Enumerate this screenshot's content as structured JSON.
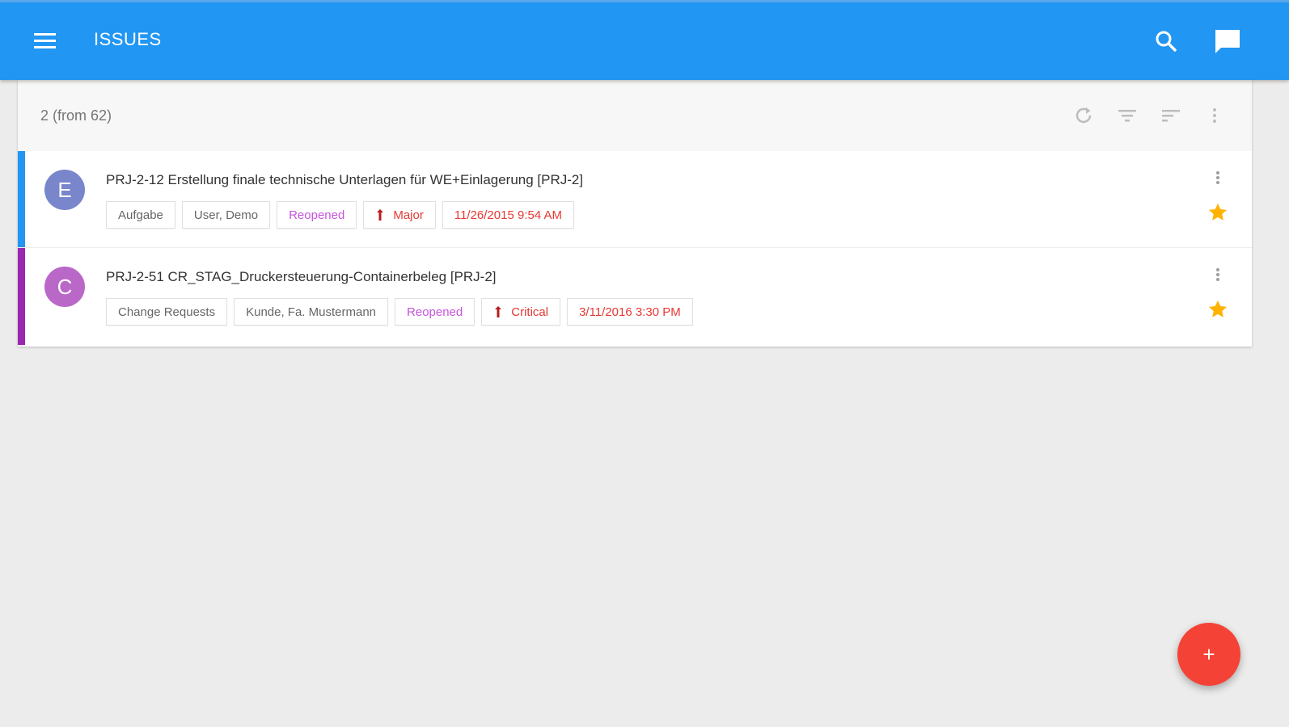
{
  "app": {
    "title": "ISSUES"
  },
  "icons": {
    "menu": "menu-icon",
    "search": "search-icon",
    "chat": "chat-icon",
    "refresh": "refresh-icon",
    "filter": "filter-icon",
    "sort": "sort-icon",
    "more": "more-vert-icon",
    "star": "star-icon",
    "priority": "priority-flag-icon",
    "add": "add-icon"
  },
  "colors": {
    "primary": "#2196f3",
    "accent_row1": "#2196f3",
    "accent_row2": "#9c27b0",
    "avatar_row1": "#7986cb",
    "avatar_row2": "#ba68c8",
    "status": "#c653de",
    "danger": "#e53935",
    "star": "#ffb300",
    "fab": "#f44336"
  },
  "list": {
    "count": "2 (from 62)",
    "items": [
      {
        "avatar": "E",
        "title": "PRJ-2-12 Erstellung finale technische Unterlagen für WE+Einlagerung [PRJ-2]",
        "type": "Aufgabe",
        "assignee": "User, Demo",
        "status": "Reopened",
        "priority": "Major",
        "date": "11/26/2015 9:54 AM",
        "starred": true
      },
      {
        "avatar": "C",
        "title": "PRJ-2-51 CR_STAG_Druckersteuerung-Containerbeleg [PRJ-2]",
        "type": "Change Requests",
        "assignee": "Kunde, Fa. Mustermann",
        "status": "Reopened",
        "priority": "Critical",
        "date": "3/11/2016 3:30 PM",
        "starred": true
      }
    ]
  },
  "fab": {
    "label": "+"
  }
}
